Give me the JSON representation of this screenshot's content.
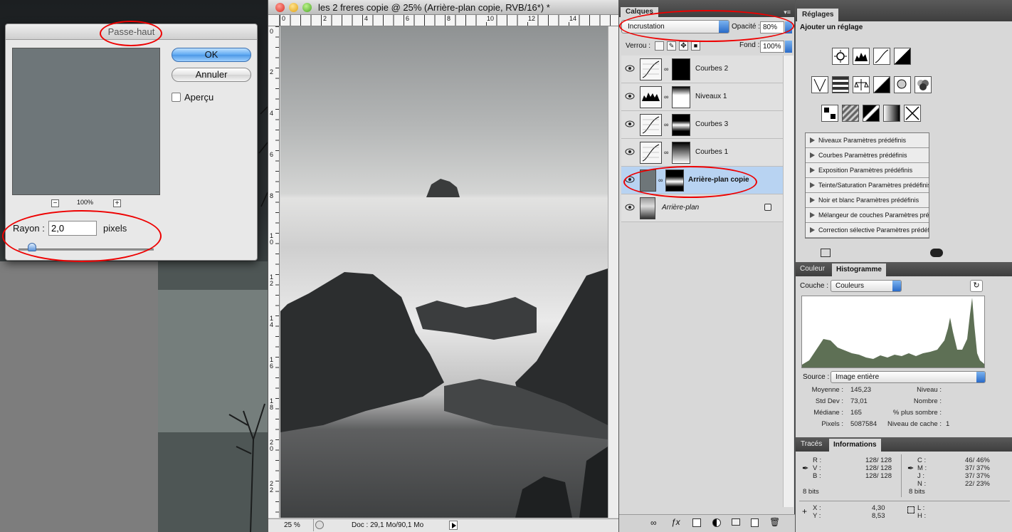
{
  "filter_dialog": {
    "title": "Passe-haut",
    "zoom": "100%",
    "zoom_out": "−",
    "zoom_in": "+",
    "ok_label": "OK",
    "cancel_label": "Annuler",
    "preview_label": "Aperçu",
    "radius_label": "Rayon :",
    "radius_value": "2,0",
    "radius_unit": "pixels"
  },
  "document": {
    "title": "les 2 freres copie @ 25% (Arrière-plan copie, RVB/16*) *",
    "ruler_top": [
      "0",
      "2",
      "4",
      "6",
      "8",
      "10",
      "12",
      "14"
    ],
    "ruler_left": [
      "0",
      "2",
      "4",
      "6",
      "8",
      "1\n0",
      "1\n2",
      "1\n4",
      "1\n6",
      "1\n8",
      "2\n0",
      "2\n2"
    ],
    "zoom": "25 %",
    "doc_info": "Doc : 29,1 Mo/90,1 Mo"
  },
  "layers_panel": {
    "tab": "Calques",
    "blend_mode": "Incrustation",
    "opacity_label": "Opacité :",
    "opacity_value": "80%",
    "lock_label": "Verrou :",
    "fill_label": "Fond :",
    "fill_value": "100%",
    "layers": [
      {
        "name": "Courbes 2",
        "type": "curves"
      },
      {
        "name": "Niveaux 1",
        "type": "levels"
      },
      {
        "name": "Courbes 3",
        "type": "curves"
      },
      {
        "name": "Courbes 1",
        "type": "curves"
      },
      {
        "name": "Arrière-plan copie",
        "type": "pixel",
        "selected": true
      },
      {
        "name": "Arrière-plan",
        "type": "background",
        "locked": true
      }
    ]
  },
  "adjustments_panel": {
    "tab": "Réglages",
    "heading": "Ajouter un réglage",
    "presets": [
      "Niveaux Paramètres prédéfinis",
      "Courbes Paramètres prédéfinis",
      "Exposition Paramètres prédéfinis",
      "Teinte/Saturation Paramètres prédéfinis",
      "Noir et blanc Paramètres prédéfinis",
      "Mélangeur de couches Paramètres préd...",
      "Correction sélective Paramètres prédéfi..."
    ]
  },
  "histogram_panel": {
    "tabs": [
      "Couleur",
      "Histogramme"
    ],
    "active_tab": "Histogramme",
    "channel_label": "Couche :",
    "channel_value": "Couleurs",
    "source_label": "Source :",
    "source_value": "Image entière",
    "stats_left": [
      {
        "label": "Moyenne :",
        "value": "145,23"
      },
      {
        "label": "Std Dev :",
        "value": "73,01"
      },
      {
        "label": "Médiane :",
        "value": "165"
      },
      {
        "label": "Pixels :",
        "value": "5087584"
      }
    ],
    "stats_right": [
      {
        "label": "Niveau :",
        "value": ""
      },
      {
        "label": "Nombre :",
        "value": ""
      },
      {
        "label": "% plus sombre :",
        "value": ""
      },
      {
        "label": "Niveau de cache :",
        "value": "1"
      }
    ],
    "fill_color": "#5e7055"
  },
  "info_panel": {
    "tabs": [
      "Tracés",
      "Informations"
    ],
    "active_tab": "Informations",
    "rgb": [
      {
        "label": "R :",
        "value": "128/ 128"
      },
      {
        "label": "V :",
        "value": "128/ 128"
      },
      {
        "label": "B :",
        "value": "128/ 128"
      }
    ],
    "cmyk": [
      {
        "label": "C :",
        "value": "46/ 46%"
      },
      {
        "label": "M :",
        "value": "37/ 37%"
      },
      {
        "label": "J :",
        "value": "37/ 37%"
      },
      {
        "label": "N :",
        "value": "22/ 23%"
      }
    ],
    "bits_left": "8 bits",
    "bits_right": "8 bits",
    "xy": [
      {
        "label": "X :",
        "value": "4,30"
      },
      {
        "label": "Y :",
        "value": "8,53"
      }
    ],
    "lh": [
      {
        "label": "L :",
        "value": ""
      },
      {
        "label": "H :",
        "value": ""
      }
    ]
  }
}
